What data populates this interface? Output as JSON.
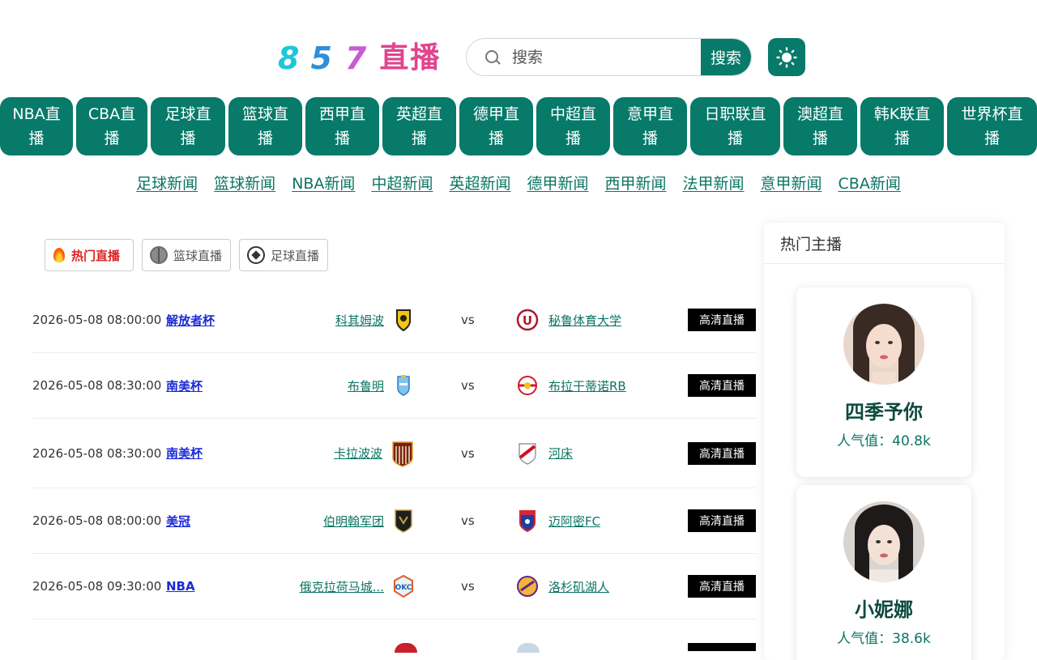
{
  "logo": {
    "d1": "8",
    "d2": "5",
    "d3": "7",
    "word": "直播"
  },
  "search": {
    "placeholder": "搜索",
    "button": "搜索"
  },
  "categories": [
    {
      "l1": "NBA直",
      "l2": "播"
    },
    {
      "l1": "CBA直",
      "l2": "播"
    },
    {
      "l1": "足球直",
      "l2": "播"
    },
    {
      "l1": "篮球直",
      "l2": "播"
    },
    {
      "l1": "西甲直",
      "l2": "播"
    },
    {
      "l1": "英超直",
      "l2": "播"
    },
    {
      "l1": "德甲直",
      "l2": "播"
    },
    {
      "l1": "中超直",
      "l2": "播"
    },
    {
      "l1": "意甲直",
      "l2": "播"
    },
    {
      "l1": "日职联直",
      "l2": "播"
    },
    {
      "l1": "澳超直",
      "l2": "播"
    },
    {
      "l1": "韩K联直",
      "l2": "播"
    },
    {
      "l1": "世界杯直",
      "l2": "播"
    }
  ],
  "news": [
    "足球新闻",
    "篮球新闻",
    "NBA新闻",
    "中超新闻",
    "英超新闻",
    "德甲新闻",
    "西甲新闻",
    "法甲新闻",
    "意甲新闻",
    "CBA新闻"
  ],
  "tabs": {
    "hot": "热门直播",
    "basketball": "篮球直播",
    "football": "足球直播"
  },
  "matches": [
    {
      "time": "2026-05-08 08:00:00",
      "league": "解放者杯",
      "home": "科其姆波",
      "vs": "vs",
      "away": "秘鲁体育大学",
      "hd": "高清直播"
    },
    {
      "time": "2026-05-08 08:30:00",
      "league": "南美杯",
      "home": "布鲁明",
      "vs": "vs",
      "away": "布拉干蒂诺RB",
      "hd": "高清直播"
    },
    {
      "time": "2026-05-08 08:30:00",
      "league": "南美杯",
      "home": "卡拉波波",
      "vs": "vs",
      "away": "河床",
      "hd": "高清直播"
    },
    {
      "time": "2026-05-08 08:00:00",
      "league": "美冠",
      "home": "伯明翰军团",
      "vs": "vs",
      "away": "迈阿密FC",
      "hd": "高清直播"
    },
    {
      "time": "2026-05-08 09:30:00",
      "league": "NBA",
      "home": "俄克拉荷马城...",
      "vs": "vs",
      "away": "洛杉矶湖人",
      "hd": "高清直播"
    }
  ],
  "sidebar": {
    "title": "热门主播",
    "anchors": [
      {
        "name": "四季予你",
        "popularity": "人气值：40.8k"
      },
      {
        "name": "小妮娜",
        "popularity": "人气值：38.6k"
      }
    ]
  },
  "colors": {
    "primary": "#077a6a",
    "link": "#0b7563",
    "league": "#1a2ad6",
    "hot": "#dd2222"
  }
}
